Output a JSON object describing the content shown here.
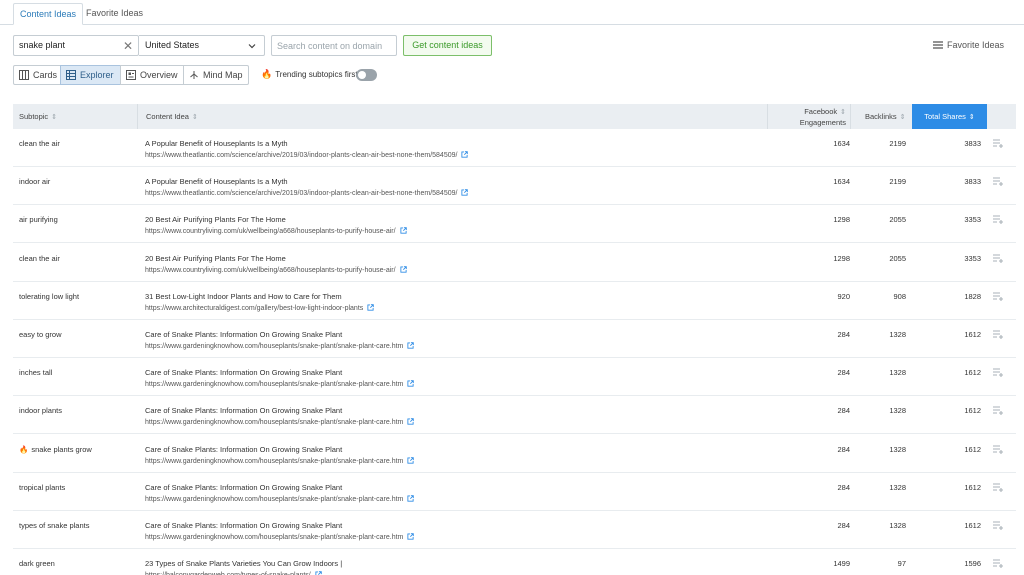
{
  "tabs": [
    {
      "label": "Content Ideas",
      "active": true
    },
    {
      "label": "Favorite Ideas",
      "active": false
    }
  ],
  "search": {
    "query": "snake plant",
    "country": "United States",
    "domain_placeholder": "Search content on domain",
    "submit_label": "Get content ideas"
  },
  "favorite_ideas_label": "Favorite Ideas",
  "views": [
    {
      "label": "Cards",
      "icon": "cards-icon",
      "active": false
    },
    {
      "label": "Explorer",
      "icon": "table-icon",
      "active": true
    },
    {
      "label": "Overview",
      "icon": "overview-icon",
      "active": false
    },
    {
      "label": "Mind Map",
      "icon": "mindmap-icon",
      "active": false
    }
  ],
  "trending": {
    "label": "Trending subtopics first",
    "enabled": false
  },
  "table": {
    "columns": {
      "subtopic": "Subtopic",
      "content_idea": "Content Idea",
      "fb_line1": "Facebook",
      "fb_line2": "Engagements",
      "backlinks": "Backlinks",
      "total_shares": "Total Shares"
    },
    "rows": [
      {
        "subtopic": "clean the air",
        "trending": false,
        "title": "A Popular Benefit of Houseplants Is a Myth",
        "url": "https://www.theatlantic.com/science/archive/2019/03/indoor-plants-clean-air-best-none-them/584509/",
        "fb": "1634",
        "backlinks": "2199",
        "total": "3833"
      },
      {
        "subtopic": "indoor air",
        "trending": false,
        "title": "A Popular Benefit of Houseplants Is a Myth",
        "url": "https://www.theatlantic.com/science/archive/2019/03/indoor-plants-clean-air-best-none-them/584509/",
        "fb": "1634",
        "backlinks": "2199",
        "total": "3833"
      },
      {
        "subtopic": "air purifying",
        "trending": false,
        "title": "20 Best Air Purifying Plants For The Home",
        "url": "https://www.countryliving.com/uk/wellbeing/a668/houseplants-to-purify-house-air/",
        "fb": "1298",
        "backlinks": "2055",
        "total": "3353"
      },
      {
        "subtopic": "clean the air",
        "trending": false,
        "title": "20 Best Air Purifying Plants For The Home",
        "url": "https://www.countryliving.com/uk/wellbeing/a668/houseplants-to-purify-house-air/",
        "fb": "1298",
        "backlinks": "2055",
        "total": "3353"
      },
      {
        "subtopic": "tolerating low light",
        "trending": false,
        "title": "31 Best Low-Light Indoor Plants and How to Care for Them",
        "url": "https://www.architecturaldigest.com/gallery/best-low-light-indoor-plants",
        "fb": "920",
        "backlinks": "908",
        "total": "1828"
      },
      {
        "subtopic": "easy to grow",
        "trending": false,
        "title": "Care of Snake Plants: Information On Growing Snake Plant",
        "url": "https://www.gardeningknowhow.com/houseplants/snake-plant/snake-plant-care.htm",
        "fb": "284",
        "backlinks": "1328",
        "total": "1612"
      },
      {
        "subtopic": "inches tall",
        "trending": false,
        "title": "Care of Snake Plants: Information On Growing Snake Plant",
        "url": "https://www.gardeningknowhow.com/houseplants/snake-plant/snake-plant-care.htm",
        "fb": "284",
        "backlinks": "1328",
        "total": "1612"
      },
      {
        "subtopic": "indoor plants",
        "trending": false,
        "title": "Care of Snake Plants: Information On Growing Snake Plant",
        "url": "https://www.gardeningknowhow.com/houseplants/snake-plant/snake-plant-care.htm",
        "fb": "284",
        "backlinks": "1328",
        "total": "1612"
      },
      {
        "subtopic": "snake plants grow",
        "trending": true,
        "title": "Care of Snake Plants: Information On Growing Snake Plant",
        "url": "https://www.gardeningknowhow.com/houseplants/snake-plant/snake-plant-care.htm",
        "fb": "284",
        "backlinks": "1328",
        "total": "1612"
      },
      {
        "subtopic": "tropical plants",
        "trending": false,
        "title": "Care of Snake Plants: Information On Growing Snake Plant",
        "url": "https://www.gardeningknowhow.com/houseplants/snake-plant/snake-plant-care.htm",
        "fb": "284",
        "backlinks": "1328",
        "total": "1612"
      },
      {
        "subtopic": "types of snake plants",
        "trending": false,
        "title": "Care of Snake Plants: Information On Growing Snake Plant",
        "url": "https://www.gardeningknowhow.com/houseplants/snake-plant/snake-plant-care.htm",
        "fb": "284",
        "backlinks": "1328",
        "total": "1612"
      },
      {
        "subtopic": "dark green",
        "trending": false,
        "title": "23 Types of Snake Plants Varieties You Can Grow Indoors |",
        "url": "https://balconygardenweb.com/types-of-snake-plants/",
        "fb": "1499",
        "backlinks": "97",
        "total": "1596"
      }
    ]
  },
  "colors": {
    "accent": "#2d8ce6",
    "green": "#3b9a2a",
    "trending": "#e85b2a"
  }
}
